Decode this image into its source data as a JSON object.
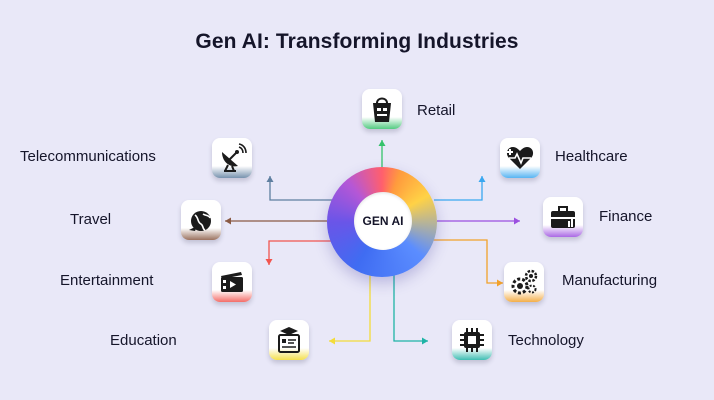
{
  "title": "Gen AI: Transforming Industries",
  "hub": {
    "label": "GEN AI"
  },
  "nodes": [
    {
      "id": "retail",
      "label": "Retail",
      "icon": "shopping-bag-icon",
      "accent": "#35c26b"
    },
    {
      "id": "healthcare",
      "label": "Healthcare",
      "icon": "heartbeat-icon",
      "accent": "#3aa7f0"
    },
    {
      "id": "finance",
      "label": "Finance",
      "icon": "briefcase-chart-icon",
      "accent": "#9b4fe0"
    },
    {
      "id": "manufacturing",
      "label": "Manufacturing",
      "icon": "gears-icon",
      "accent": "#f2a12a"
    },
    {
      "id": "technology",
      "label": "Technology",
      "icon": "microchip-icon",
      "accent": "#1fb3a6"
    },
    {
      "id": "education",
      "label": "Education",
      "icon": "graduation-cap-icon",
      "accent": "#f3dc3a"
    },
    {
      "id": "entertainment",
      "label": "Entertainment",
      "icon": "film-clapper-icon",
      "accent": "#f2554f"
    },
    {
      "id": "travel",
      "label": "Travel",
      "icon": "globe-plane-icon",
      "accent": "#8a5a44"
    },
    {
      "id": "telecommunications",
      "label": "Telecommunications",
      "icon": "satellite-dish-icon",
      "accent": "#5f7fa0"
    }
  ]
}
